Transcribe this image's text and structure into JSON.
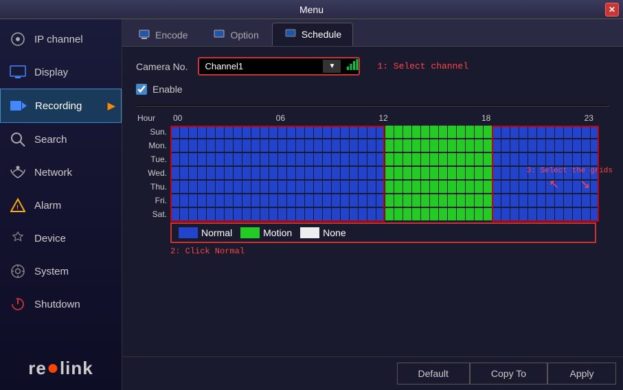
{
  "titleBar": {
    "title": "Menu",
    "closeBtn": "✕"
  },
  "sidebar": {
    "items": [
      {
        "id": "ip-channel",
        "label": "IP channel",
        "icon": "👁",
        "active": false
      },
      {
        "id": "display",
        "label": "Display",
        "icon": "🖥",
        "active": false
      },
      {
        "id": "recording",
        "label": "Recording",
        "icon": "📹",
        "active": true,
        "hasArrow": true
      },
      {
        "id": "search",
        "label": "Search",
        "icon": "🔍",
        "active": false
      },
      {
        "id": "network",
        "label": "Network",
        "icon": "📡",
        "active": false
      },
      {
        "id": "alarm",
        "label": "Alarm",
        "icon": "⚠",
        "active": false
      },
      {
        "id": "device",
        "label": "Device",
        "icon": "⚙",
        "active": false
      },
      {
        "id": "system",
        "label": "System",
        "icon": "⚙",
        "active": false
      },
      {
        "id": "shutdown",
        "label": "Shutdown",
        "icon": "⏻",
        "active": false
      }
    ],
    "logo": "reolink"
  },
  "tabs": [
    {
      "id": "encode",
      "label": "Encode",
      "active": false
    },
    {
      "id": "option",
      "label": "Option",
      "active": false
    },
    {
      "id": "schedule",
      "label": "Schedule",
      "active": true
    }
  ],
  "schedule": {
    "cameraLabel": "Camera No.",
    "cameraValue": "Channel1",
    "hint1": "1: Select channel",
    "enableLabel": "Enable",
    "enableChecked": true,
    "hourLabel": "Hour",
    "hours": [
      "00",
      "06",
      "12",
      "18",
      "23"
    ],
    "days": [
      "Sun.",
      "Mon.",
      "Tue.",
      "Wed.",
      "Thu.",
      "Fri.",
      "Sat."
    ],
    "legend": {
      "items": [
        {
          "id": "normal",
          "label": "Normal",
          "color": "#2244cc"
        },
        {
          "id": "motion",
          "label": "Motion",
          "color": "#22cc22"
        },
        {
          "id": "none",
          "label": "None",
          "color": "#eeeeee"
        }
      ]
    },
    "hint2": "2: Click Normal",
    "hint3": "3: Select the grids",
    "buttons": {
      "default": "Default",
      "copyTo": "Copy To",
      "apply": "Apply"
    }
  }
}
